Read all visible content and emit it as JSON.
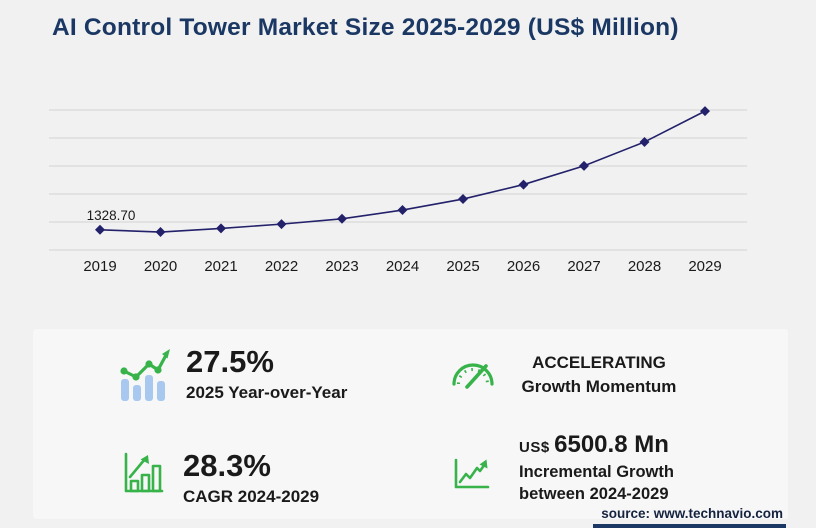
{
  "header": {
    "title": "AI Control Tower Market Size 2025-2029 (US$ Million)"
  },
  "chart_data": {
    "type": "line",
    "title": "AI Control Tower Market Size 2025-2029 (US$ Million)",
    "x": [
      "2019",
      "2020",
      "2021",
      "2022",
      "2023",
      "2024",
      "2025",
      "2026",
      "2027",
      "2028",
      "2029"
    ],
    "values": [
      1328.7,
      1180,
      1420,
      1700,
      2050,
      2625.4,
      3347.4,
      4300,
      5530,
      7100,
      9126.2
    ],
    "point_labels": [
      {
        "x": "2019",
        "text": "1328.70"
      }
    ],
    "ylim": [
      0,
      9200
    ],
    "gridline_count": 6,
    "grid": true,
    "legend": false,
    "marker": "diamond"
  },
  "stats": [
    {
      "icon": "bar-trend-icon",
      "value": "27.5%",
      "label": "2025 Year-over-Year"
    },
    {
      "icon": "speedometer-icon",
      "line1": "ACCELERATING",
      "line2": "Growth Momentum"
    },
    {
      "icon": "bar-growth-icon",
      "value": "28.3%",
      "label": "CAGR 2024-2029"
    },
    {
      "icon": "line-growth-icon",
      "currency": "US$",
      "value": "6500.8 Mn",
      "label_line1": "Incremental Growth",
      "label_line2": "between 2024-2029"
    }
  ],
  "footer": {
    "source": "source: www.technavio.com"
  },
  "colors": {
    "bg": "#f1f1f2",
    "card": "#f7f7f8",
    "navy": "#1a3863",
    "line": "#23216a",
    "grid": "#d2d2d4",
    "text": "#1a1a1a",
    "green": "#37b34a",
    "blue": "#a9c8ef"
  }
}
